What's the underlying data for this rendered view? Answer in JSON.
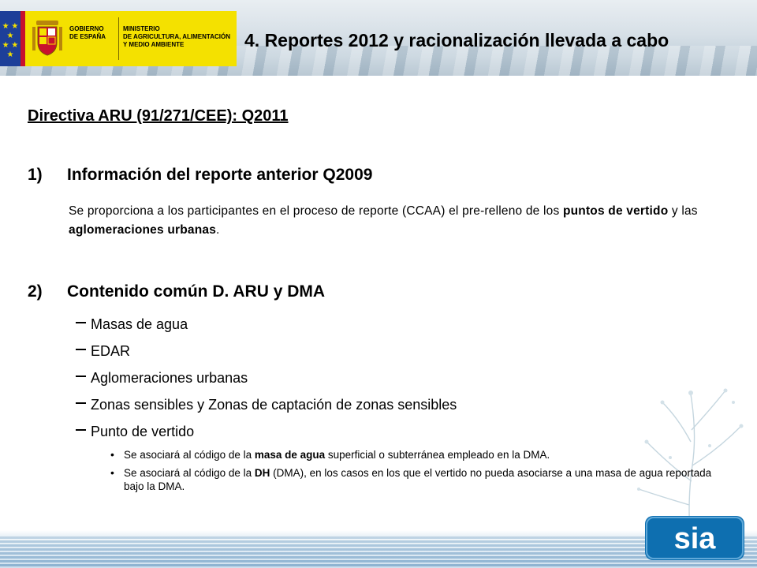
{
  "header": {
    "gov_line1": "GOBIERNO",
    "gov_line2": "DE ESPAÑA",
    "ministry_line1": "MINISTERIO",
    "ministry_line2": "DE AGRICULTURA, ALIMENTACIÓN",
    "ministry_line3": "Y MEDIO AMBIENTE",
    "slide_title": "4. Reportes 2012 y racionalización llevada a cabo",
    "colors": {
      "flag_blue": "#1d3f99",
      "flag_yellow": "#f4e100",
      "flag_red": "#c8102e"
    }
  },
  "main": {
    "section_title": "Directiva ARU (91/271/CEE): Q2011",
    "item1": {
      "number": "1)",
      "heading": "Información del reporte anterior Q2009",
      "text_a": "Se proporciona a los participantes en el proceso de reporte (CCAA) el pre-relleno de los ",
      "bold_a": "puntos de vertido",
      "text_b": " y las ",
      "bold_b": "aglomeraciones urbanas",
      "text_c": "."
    },
    "item2": {
      "number": "2)",
      "heading": "Contenido común D. ARU y DMA",
      "list": [
        "Masas de agua",
        "EDAR",
        "Aglomeraciones urbanas",
        "Zonas sensibles y Zonas de captación de zonas sensibles",
        "Punto de vertido"
      ],
      "sub_bullets": [
        {
          "pre": "Se asociará al código de la ",
          "bold": "masa de agua",
          "post": " superficial o subterránea empleado en la DMA."
        },
        {
          "pre": "Se asociará al código de la ",
          "bold": "DH",
          "post": " (DMA), en los casos en los que el vertido no pueda asociarse a una masa de agua reportada bajo la DMA."
        }
      ]
    }
  },
  "footer": {
    "logo_text": "sia",
    "logo_color": "#0e6fb0"
  }
}
